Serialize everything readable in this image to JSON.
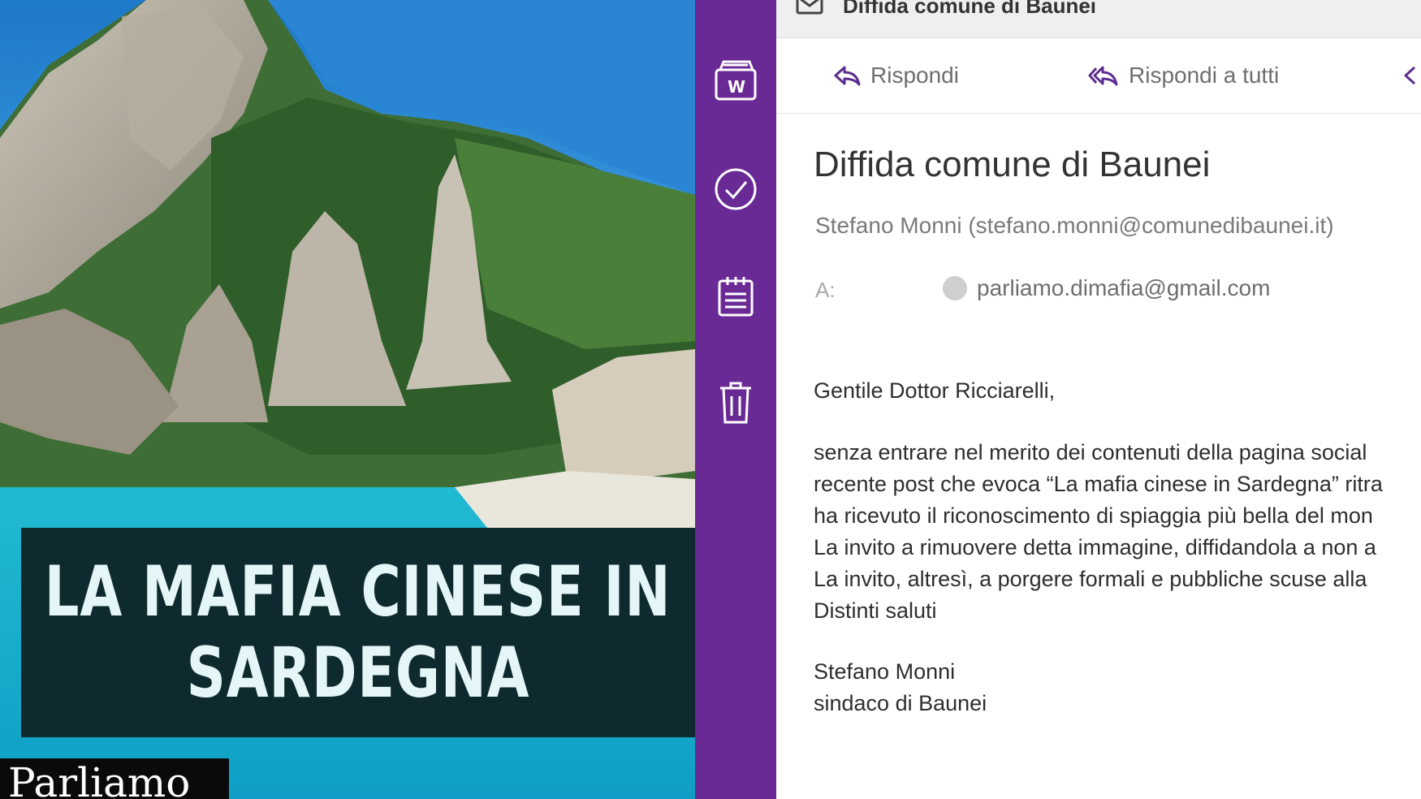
{
  "thumbnail": {
    "headline_lines": [
      "LA MAFIA CINESE IN",
      "SARDEGNA"
    ],
    "brand": "Parliamo"
  },
  "sidebar": {
    "items": [
      {
        "icon": "word-document-icon"
      },
      {
        "icon": "checkmark-circle-icon"
      },
      {
        "icon": "calendar-icon"
      },
      {
        "icon": "trash-icon"
      }
    ],
    "color": "#6a2a96"
  },
  "email": {
    "window_title": "Diffida comune di Baunei",
    "toolbar": {
      "reply": "Rispondi",
      "reply_all": "Rispondi a tutti"
    },
    "subject": "Diffida comune di Baunei",
    "sender": "Stefano Monni (stefano.monni@comunedibaunei.it)",
    "to_label": "A:",
    "recipient": "parliamo.dimafia@gmail.com",
    "greeting": "Gentile Dottor Ricciarelli,",
    "body_lines": [
      "senza entrare nel merito dei contenuti della pagina social",
      "recente post che evoca “La mafia cinese in Sardegna” ritra",
      "ha ricevuto il riconoscimento di spiaggia più bella del mon",
      "La invito a rimuovere detta immagine, diffidandola a non a",
      "La invito, altresì, a porgere formali  e pubbliche scuse alla",
      "Distinti saluti"
    ],
    "signature_name": "Stefano Monni",
    "signature_title": "sindaco di Baunei",
    "accent_color": "#5b2d8e"
  }
}
